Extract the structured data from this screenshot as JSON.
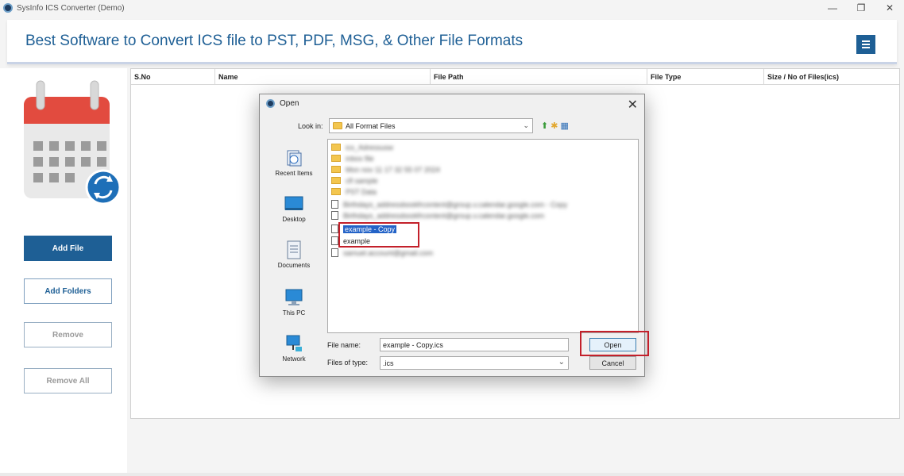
{
  "app": {
    "title": "SysInfo ICS Converter (Demo)",
    "headline": "Best Software to Convert ICS file to PST, PDF, MSG, & Other File Formats"
  },
  "window_controls": {
    "minimize": "—",
    "maximize": "❐",
    "close": "✕"
  },
  "sidebar": {
    "buttons": [
      {
        "label": "Add File"
      },
      {
        "label": "Add Folders"
      },
      {
        "label": "Remove"
      },
      {
        "label": "Remove All"
      }
    ]
  },
  "table": {
    "columns": [
      "S.No",
      "Name",
      "File Path",
      "File Type",
      "Size / No of Files(ics)"
    ]
  },
  "dialog": {
    "title": "Open",
    "close_glyph": "✕",
    "look_in_label": "Look in:",
    "look_in_value": "All Format Files",
    "places": [
      "Recent Items",
      "Desktop",
      "Documents",
      "This PC",
      "Network"
    ],
    "files": [
      {
        "type": "folder",
        "name": "ics_Adressusw",
        "blurred": true
      },
      {
        "type": "folder",
        "name": "inbox file",
        "blurred": true
      },
      {
        "type": "folder",
        "name": "Mon nov 11 17 32 55 07 2024",
        "blurred": true
      },
      {
        "type": "folder",
        "name": "cfl sample",
        "blurred": true
      },
      {
        "type": "folder",
        "name": "PST Data",
        "blurred": true
      },
      {
        "type": "file",
        "name": "Birthdays_addressbookfrcontent@group.v.calendar.google.com - Copy",
        "blurred": true
      },
      {
        "type": "file",
        "name": "Birthdays_addressbookfrcontent@group.v.calendar.google.com",
        "blurred": true
      },
      {
        "type": "file",
        "name": "example - Copy",
        "blurred": false,
        "selected": true
      },
      {
        "type": "file",
        "name": "example",
        "blurred": false
      },
      {
        "type": "file",
        "name": "samuel.account@gmail.com",
        "blurred": true
      }
    ],
    "file_name_label": "File name:",
    "file_name_value": "example - Copy.ics",
    "files_of_type_label": "Files of type:",
    "files_of_type_value": ".ics",
    "open_label": "Open",
    "cancel_label": "Cancel"
  },
  "colors": {
    "accent": "#1e5f95",
    "highlight": "#c3202a",
    "selection": "#2463c7"
  }
}
